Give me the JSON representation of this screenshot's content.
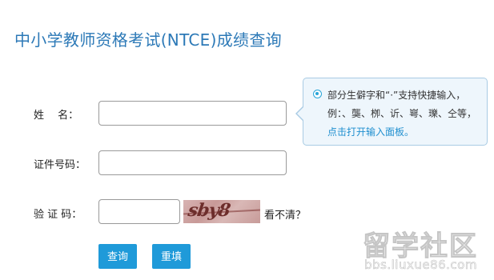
{
  "page": {
    "title": "中小学教师资格考试(NTCE)成绩查询"
  },
  "form": {
    "name_label": "姓　 名：",
    "id_label": "证件号码：",
    "captcha_label": "验 证 码：",
    "name_value": "",
    "id_value": "",
    "captcha_value": "",
    "captcha_image_text": "sby8",
    "refresh_label": "看不清？",
    "query_button": "查询",
    "reset_button": "重填"
  },
  "tip": {
    "text": "部分生僻字和“·”支持快捷输入，例：、龑、栁、䜣、㟧、瓅、仝等，",
    "link": "点击打开输入面板。"
  },
  "watermark": {
    "main": "留学社区",
    "url": "bbs.liuxue86.com"
  },
  "colors": {
    "title": "#2c79b7",
    "button": "#1f9ad9",
    "tip_background": "#eef6fc",
    "tip_border": "#a9cbe4",
    "link": "#1f8fcf"
  }
}
